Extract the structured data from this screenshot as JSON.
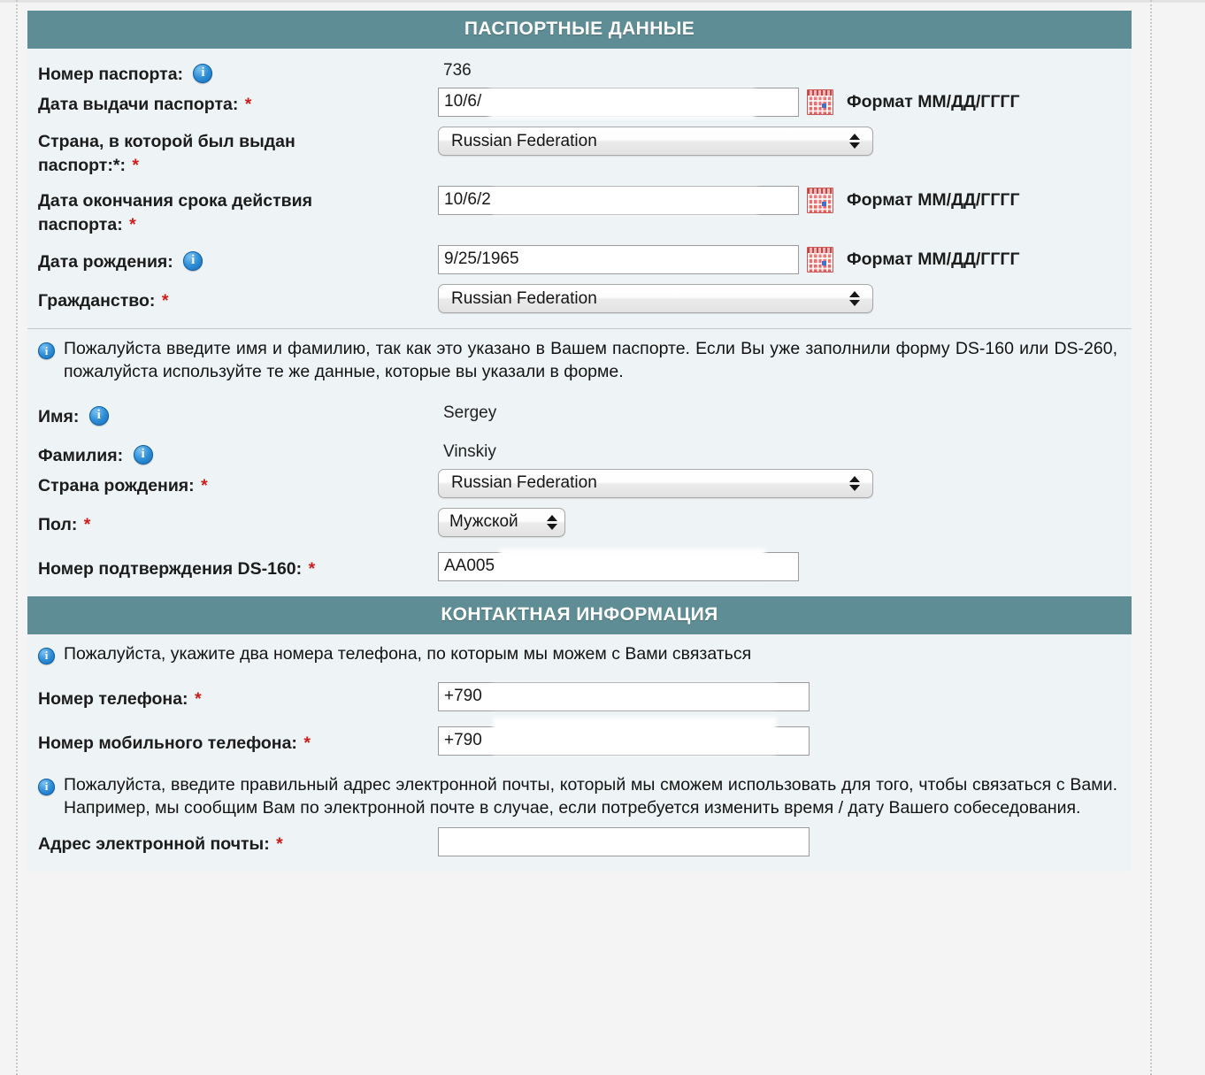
{
  "sections": {
    "passport": {
      "header": "ПАСПОРТНЫЕ ДАННЫЕ",
      "fields": {
        "passport_number": {
          "label": "Номер паспорта:",
          "value": "736",
          "info_icon": "info-icon"
        },
        "issue_date": {
          "label": "Дата выдачи паспорта:",
          "required": "*",
          "value": "10/6/",
          "hint": "Формат ММ/ДД/ГГГГ",
          "calendar_icon": "calendar-icon"
        },
        "issue_country": {
          "label_line1": "Страна, в которой был выдан",
          "label_line2": "паспорт:*:",
          "required": "*",
          "value": "Russian Federation"
        },
        "expiry_date": {
          "label_line1": "Дата окончания срока действия",
          "label_line2": "паспорта:",
          "required": "*",
          "value": "10/6/2",
          "hint": "Формат ММ/ДД/ГГГГ",
          "calendar_icon": "calendar-icon"
        },
        "birth_date": {
          "label": "Дата рождения:",
          "value": "9/25/1965",
          "hint": "Формат ММ/ДД/ГГГГ",
          "info_icon": "info-icon",
          "calendar_icon": "calendar-icon"
        },
        "citizenship": {
          "label": "Гражданство:",
          "required": "*",
          "value": "Russian Federation"
        },
        "name_note": "Пожалуйста введите имя и фамилию, так как это указано в Вашем паспорте. Если Вы уже заполнили форму DS-160 или DS-260, пожалуйста используйте те же данные, которые вы указали в форме.",
        "first_name": {
          "label": "Имя:",
          "value": "Sergey",
          "info_icon": "info-icon"
        },
        "last_name": {
          "label": "Фамилия:",
          "value": "Vinskiy",
          "info_icon": "info-icon"
        },
        "birth_country": {
          "label": "Страна рождения:",
          "required": "*",
          "value": "Russian Federation"
        },
        "gender": {
          "label": "Пол:",
          "required": "*",
          "value": "Мужской"
        },
        "ds160_number": {
          "label": "Номер подтверждения DS-160:",
          "required": "*",
          "value": "AA005"
        }
      }
    },
    "contact": {
      "header": "КОНТАКТНАЯ ИНФОРМАЦИЯ",
      "phone_note": "Пожалуйста, укажите два номера телефона, по которым мы можем с Вами связаться",
      "fields": {
        "phone": {
          "label": "Номер телефона:",
          "required": "*",
          "value": "+790"
        },
        "mobile_phone": {
          "label": "Номер мобильного телефона:",
          "required": "*",
          "value": "+790"
        },
        "email_note": "Пожалуйста, введите правильный адрес электронной почты, который мы сможем использовать для того, чтобы связаться с Вами. Например, мы сообщим Вам по электронной почте в случае, если потребуется изменить время / дату Вашего собеседования.",
        "email": {
          "label": "Адрес электронной почты:",
          "required": "*",
          "value": ""
        }
      }
    }
  },
  "colors": {
    "section_header_bg": "#5f8d95",
    "card_bg": "#eef4f5",
    "page_bg": "#f4f4f4",
    "required_asterisk": "#d11b1b",
    "info_icon": "#2d8ed6",
    "calendar_icon": "#e05d5d"
  }
}
